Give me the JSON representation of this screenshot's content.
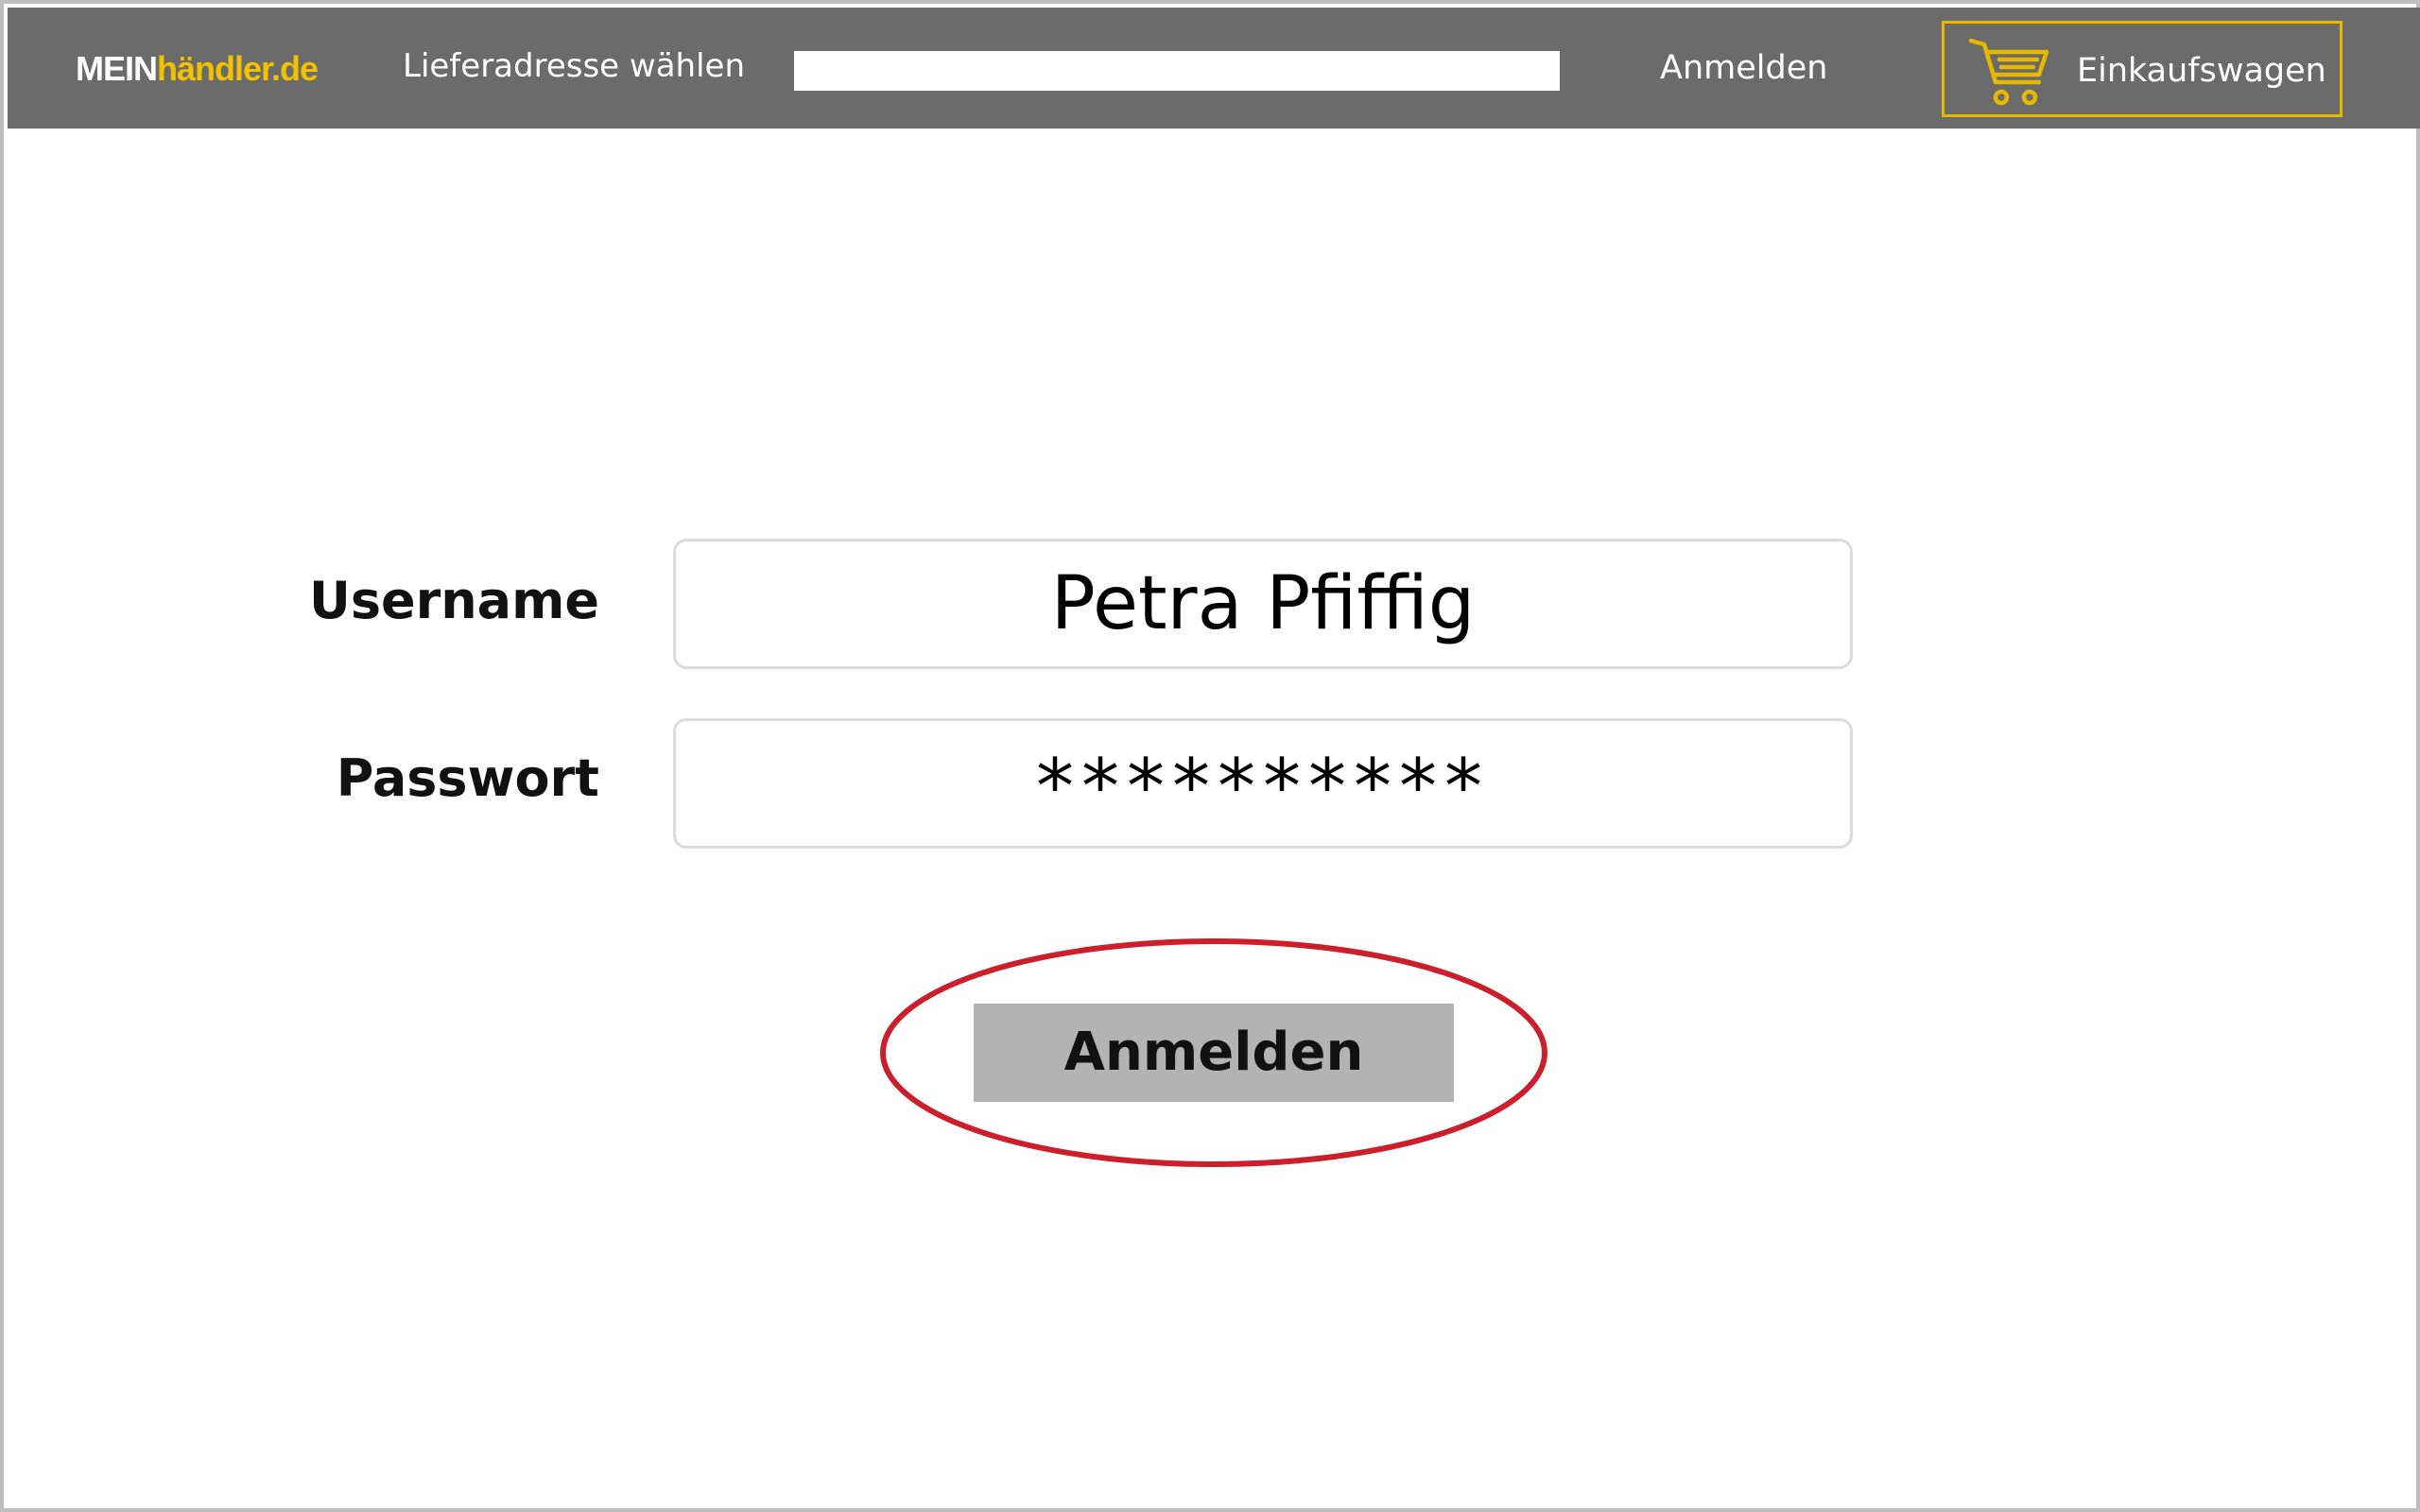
{
  "header": {
    "logo_part1": "MEIN",
    "logo_part2": "händler.de",
    "delivery_address_label": "Lieferadresse wählen",
    "search_value": "",
    "login_link": "Anmelden",
    "cart_icon": "shopping-cart-icon",
    "cart_label": "Einkaufswagen"
  },
  "login_form": {
    "username_label": "Username",
    "username_value": "Petra Pfiffig",
    "password_label": "Passwort",
    "password_value": "**********",
    "submit_label": "Anmelden"
  },
  "colors": {
    "header_bg": "#6b6b6b",
    "logo_accent": "#f2c200",
    "cart_border": "#e6b800",
    "button_bg": "#b3b3b3",
    "highlight_ring": "#cc1f2b"
  }
}
